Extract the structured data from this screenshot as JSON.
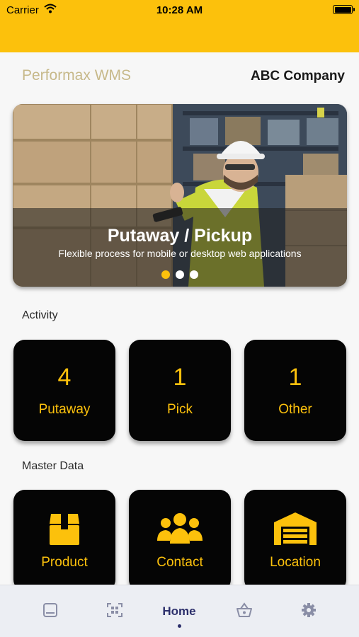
{
  "status_bar": {
    "carrier": "Carrier",
    "time": "10:28 AM",
    "icons": [
      "wifi-icon",
      "battery-icon"
    ]
  },
  "header": {
    "app_name": "Performax WMS",
    "company": "ABC Company"
  },
  "banner": {
    "title": "Putaway / Pickup",
    "subtitle": "Flexible process for mobile or desktop web applications",
    "slides": 3,
    "active_slide": 1
  },
  "activity": {
    "title": "Activity",
    "tiles": [
      {
        "count": "4",
        "label": "Putaway"
      },
      {
        "count": "1",
        "label": "Pick"
      },
      {
        "count": "1",
        "label": "Other"
      }
    ]
  },
  "master_data": {
    "title": "Master Data",
    "tiles": [
      {
        "label": "Product",
        "icon": "box-icon"
      },
      {
        "label": "Contact",
        "icon": "people-icon"
      },
      {
        "label": "Location",
        "icon": "warehouse-icon"
      }
    ]
  },
  "bottom_nav": {
    "items": [
      {
        "icon": "image-icon"
      },
      {
        "icon": "qr-scan-icon"
      },
      {
        "label": "Home",
        "active": true
      },
      {
        "icon": "basket-icon"
      },
      {
        "icon": "gear-icon"
      }
    ]
  },
  "colors": {
    "accent": "#fcc10c",
    "tile_bg": "#050505",
    "nav_active": "#2c2f6b",
    "nav_inactive": "#8a8ea6"
  }
}
